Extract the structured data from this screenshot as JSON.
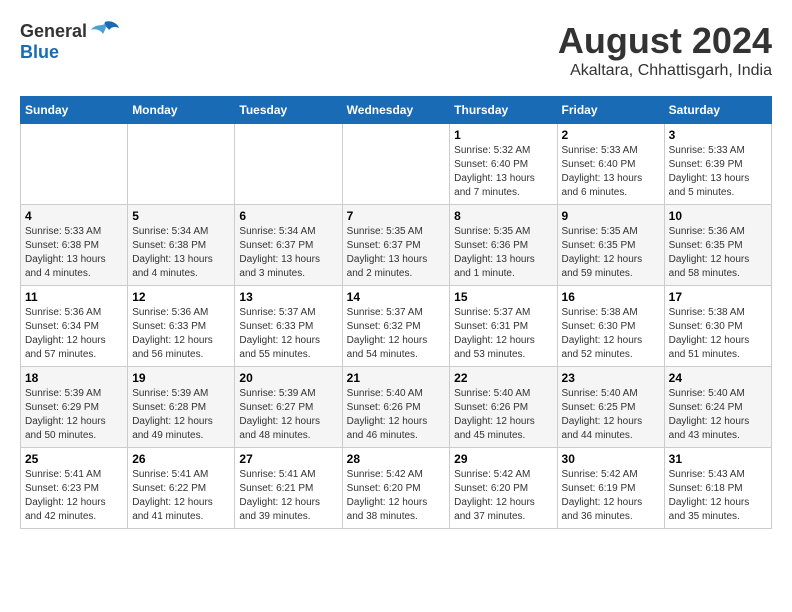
{
  "logo": {
    "general": "General",
    "blue": "Blue"
  },
  "title": {
    "month_year": "August 2024",
    "location": "Akaltara, Chhattisgarh, India"
  },
  "days_of_week": [
    "Sunday",
    "Monday",
    "Tuesday",
    "Wednesday",
    "Thursday",
    "Friday",
    "Saturday"
  ],
  "weeks": [
    [
      {
        "day": "",
        "info": ""
      },
      {
        "day": "",
        "info": ""
      },
      {
        "day": "",
        "info": ""
      },
      {
        "day": "",
        "info": ""
      },
      {
        "day": "1",
        "info": "Sunrise: 5:32 AM\nSunset: 6:40 PM\nDaylight: 13 hours\nand 7 minutes."
      },
      {
        "day": "2",
        "info": "Sunrise: 5:33 AM\nSunset: 6:40 PM\nDaylight: 13 hours\nand 6 minutes."
      },
      {
        "day": "3",
        "info": "Sunrise: 5:33 AM\nSunset: 6:39 PM\nDaylight: 13 hours\nand 5 minutes."
      }
    ],
    [
      {
        "day": "4",
        "info": "Sunrise: 5:33 AM\nSunset: 6:38 PM\nDaylight: 13 hours\nand 4 minutes."
      },
      {
        "day": "5",
        "info": "Sunrise: 5:34 AM\nSunset: 6:38 PM\nDaylight: 13 hours\nand 4 minutes."
      },
      {
        "day": "6",
        "info": "Sunrise: 5:34 AM\nSunset: 6:37 PM\nDaylight: 13 hours\nand 3 minutes."
      },
      {
        "day": "7",
        "info": "Sunrise: 5:35 AM\nSunset: 6:37 PM\nDaylight: 13 hours\nand 2 minutes."
      },
      {
        "day": "8",
        "info": "Sunrise: 5:35 AM\nSunset: 6:36 PM\nDaylight: 13 hours\nand 1 minute."
      },
      {
        "day": "9",
        "info": "Sunrise: 5:35 AM\nSunset: 6:35 PM\nDaylight: 12 hours\nand 59 minutes."
      },
      {
        "day": "10",
        "info": "Sunrise: 5:36 AM\nSunset: 6:35 PM\nDaylight: 12 hours\nand 58 minutes."
      }
    ],
    [
      {
        "day": "11",
        "info": "Sunrise: 5:36 AM\nSunset: 6:34 PM\nDaylight: 12 hours\nand 57 minutes."
      },
      {
        "day": "12",
        "info": "Sunrise: 5:36 AM\nSunset: 6:33 PM\nDaylight: 12 hours\nand 56 minutes."
      },
      {
        "day": "13",
        "info": "Sunrise: 5:37 AM\nSunset: 6:33 PM\nDaylight: 12 hours\nand 55 minutes."
      },
      {
        "day": "14",
        "info": "Sunrise: 5:37 AM\nSunset: 6:32 PM\nDaylight: 12 hours\nand 54 minutes."
      },
      {
        "day": "15",
        "info": "Sunrise: 5:37 AM\nSunset: 6:31 PM\nDaylight: 12 hours\nand 53 minutes."
      },
      {
        "day": "16",
        "info": "Sunrise: 5:38 AM\nSunset: 6:30 PM\nDaylight: 12 hours\nand 52 minutes."
      },
      {
        "day": "17",
        "info": "Sunrise: 5:38 AM\nSunset: 6:30 PM\nDaylight: 12 hours\nand 51 minutes."
      }
    ],
    [
      {
        "day": "18",
        "info": "Sunrise: 5:39 AM\nSunset: 6:29 PM\nDaylight: 12 hours\nand 50 minutes."
      },
      {
        "day": "19",
        "info": "Sunrise: 5:39 AM\nSunset: 6:28 PM\nDaylight: 12 hours\nand 49 minutes."
      },
      {
        "day": "20",
        "info": "Sunrise: 5:39 AM\nSunset: 6:27 PM\nDaylight: 12 hours\nand 48 minutes."
      },
      {
        "day": "21",
        "info": "Sunrise: 5:40 AM\nSunset: 6:26 PM\nDaylight: 12 hours\nand 46 minutes."
      },
      {
        "day": "22",
        "info": "Sunrise: 5:40 AM\nSunset: 6:26 PM\nDaylight: 12 hours\nand 45 minutes."
      },
      {
        "day": "23",
        "info": "Sunrise: 5:40 AM\nSunset: 6:25 PM\nDaylight: 12 hours\nand 44 minutes."
      },
      {
        "day": "24",
        "info": "Sunrise: 5:40 AM\nSunset: 6:24 PM\nDaylight: 12 hours\nand 43 minutes."
      }
    ],
    [
      {
        "day": "25",
        "info": "Sunrise: 5:41 AM\nSunset: 6:23 PM\nDaylight: 12 hours\nand 42 minutes."
      },
      {
        "day": "26",
        "info": "Sunrise: 5:41 AM\nSunset: 6:22 PM\nDaylight: 12 hours\nand 41 minutes."
      },
      {
        "day": "27",
        "info": "Sunrise: 5:41 AM\nSunset: 6:21 PM\nDaylight: 12 hours\nand 39 minutes."
      },
      {
        "day": "28",
        "info": "Sunrise: 5:42 AM\nSunset: 6:20 PM\nDaylight: 12 hours\nand 38 minutes."
      },
      {
        "day": "29",
        "info": "Sunrise: 5:42 AM\nSunset: 6:20 PM\nDaylight: 12 hours\nand 37 minutes."
      },
      {
        "day": "30",
        "info": "Sunrise: 5:42 AM\nSunset: 6:19 PM\nDaylight: 12 hours\nand 36 minutes."
      },
      {
        "day": "31",
        "info": "Sunrise: 5:43 AM\nSunset: 6:18 PM\nDaylight: 12 hours\nand 35 minutes."
      }
    ]
  ]
}
